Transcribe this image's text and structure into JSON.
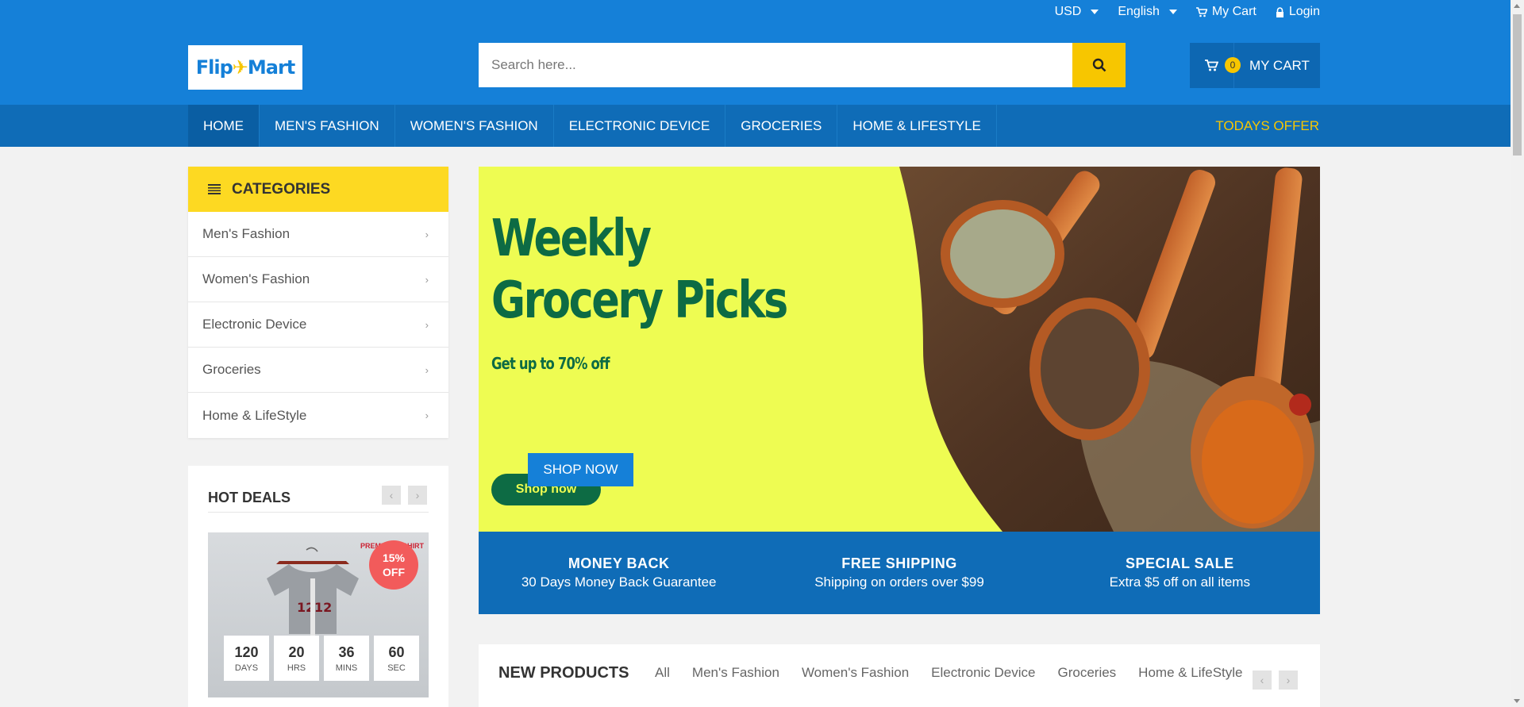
{
  "colors": {
    "primary": "#1580d8",
    "nav": "#0f6cb7",
    "accent_yellow": "#f7c600",
    "category_header": "#fdd922",
    "hero_green": "#0d6b44",
    "hero_bg": "#eefc52",
    "badge_red": "#f25b5b"
  },
  "top_links": {
    "currency": "USD",
    "language": "English",
    "my_cart": "My Cart",
    "login": "Login"
  },
  "logo": {
    "part1": "Flip",
    "part2": "Mart"
  },
  "search": {
    "placeholder": "Search here..."
  },
  "cart": {
    "count": "0",
    "label": "MY CART"
  },
  "nav": {
    "items": [
      "HOME",
      "MEN'S FASHION",
      "WOMEN'S FASHION",
      "ELECTRONIC DEVICE",
      "GROCERIES",
      "HOME & LIFESTYLE"
    ],
    "offer": "TODAYS OFFER"
  },
  "categories": {
    "title": "CATEGORIES",
    "items": [
      "Men's Fashion",
      "Women's Fashion",
      "Electronic Device",
      "Groceries",
      "Home & LifeStyle"
    ]
  },
  "hot_deals": {
    "title": "HOT DEALS",
    "badge_pct": "15%",
    "badge_off": "OFF",
    "promo_line1": "PREMIUM T-SHIRT",
    "countdown": [
      {
        "value": "120",
        "unit": "DAYS"
      },
      {
        "value": "20",
        "unit": "HRS"
      },
      {
        "value": "36",
        "unit": "MINS"
      },
      {
        "value": "60",
        "unit": "SEC"
      }
    ]
  },
  "hero": {
    "title_line1": "Weekly",
    "title_line2": "Grocery Picks",
    "subtitle": "Get up to 70% off",
    "inner_button": "Shop now",
    "cta": "SHOP NOW"
  },
  "info_bar": [
    {
      "title": "MONEY BACK",
      "subtitle": "30 Days Money Back Guarantee"
    },
    {
      "title": "FREE SHIPPING",
      "subtitle": "Shipping on orders over $99"
    },
    {
      "title": "SPECIAL SALE",
      "subtitle": "Extra $5 off on all items"
    }
  ],
  "new_products": {
    "title": "NEW PRODUCTS",
    "tabs": [
      "All",
      "Men's Fashion",
      "Women's Fashion",
      "Electronic Device",
      "Groceries",
      "Home & LifeStyle"
    ]
  }
}
